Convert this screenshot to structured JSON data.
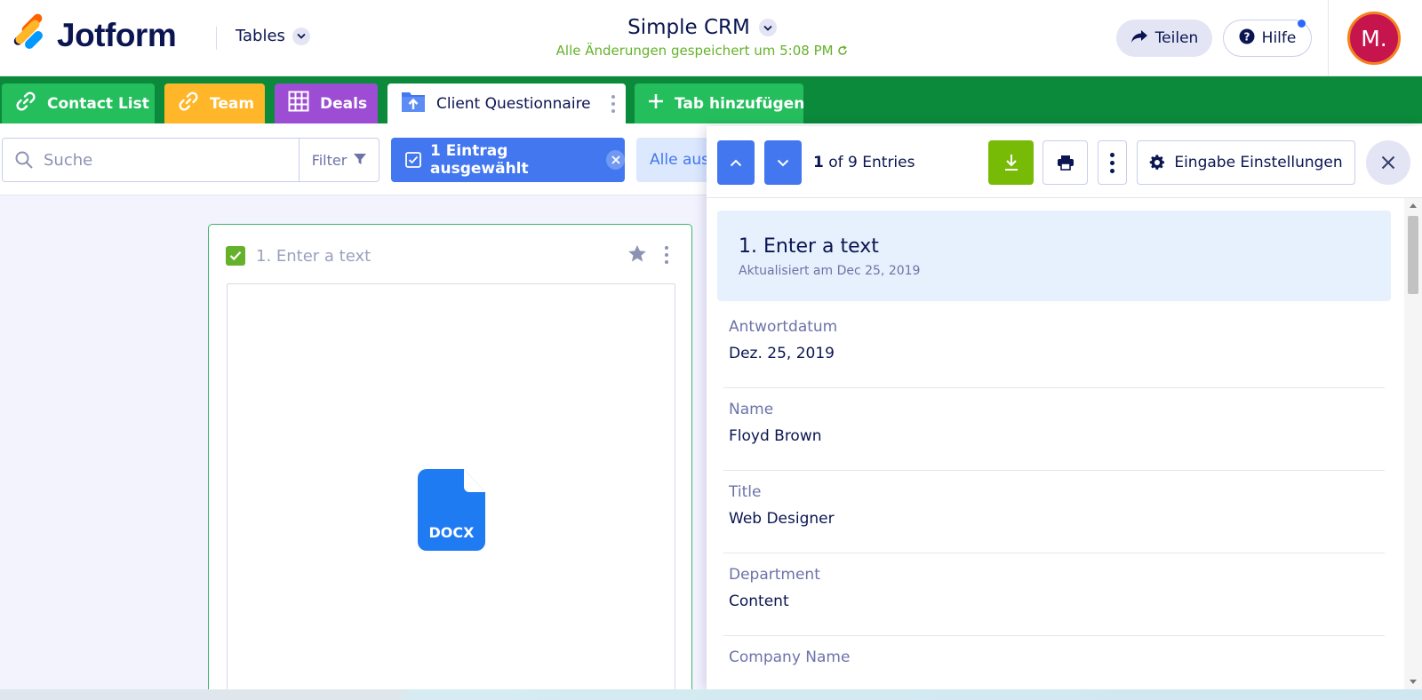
{
  "brand": {
    "name": "Jotform"
  },
  "header": {
    "tables_label": "Tables",
    "doc_title": "Simple CRM",
    "save_status": "Alle Änderungen gespeichert um 5:08 PM",
    "share_label": "Teilen",
    "help_label": "Hilfe",
    "avatar_initial": "M."
  },
  "tabs": [
    {
      "label": "Contact List",
      "icon": "link-icon",
      "color": "#25be5d"
    },
    {
      "label": "Team",
      "icon": "link-icon",
      "color": "#ffb629"
    },
    {
      "label": "Deals",
      "icon": "table-grid-icon",
      "color": "#9c4dd3"
    },
    {
      "label": "Client Questionnaire",
      "icon": "folder-upload-icon",
      "active": true
    },
    {
      "label": "Tab hinzufügen",
      "icon": "plus-icon",
      "color": "#25be5d"
    }
  ],
  "toolbar": {
    "search_placeholder": "Suche",
    "filter_label": "Filter",
    "selected_label": "1 Eintrag ausgewählt",
    "select_all_label": "Alle aus"
  },
  "card": {
    "title": "1. Enter a text",
    "checked": true,
    "file_type": "DOCX"
  },
  "panel": {
    "current": "1",
    "count_text": "of 9 Entries",
    "settings_label": "Eingabe Einstellungen",
    "entry_title": "1. Enter a text",
    "updated": "Aktualisiert am Dec 25, 2019",
    "fields": [
      {
        "label": "Antwortdatum",
        "value": "Dez. 25, 2019"
      },
      {
        "label": "Name",
        "value": "Floyd Brown"
      },
      {
        "label": "Title",
        "value": "Web Designer"
      },
      {
        "label": "Department",
        "value": "Content"
      },
      {
        "label": "Company Name",
        "value": ""
      }
    ]
  },
  "colors": {
    "tab_bar": "#0a8a3a",
    "accent_blue": "#4277f0",
    "download_green": "#78bb07",
    "save_green": "#64b22b",
    "navy": "#0a1551"
  }
}
